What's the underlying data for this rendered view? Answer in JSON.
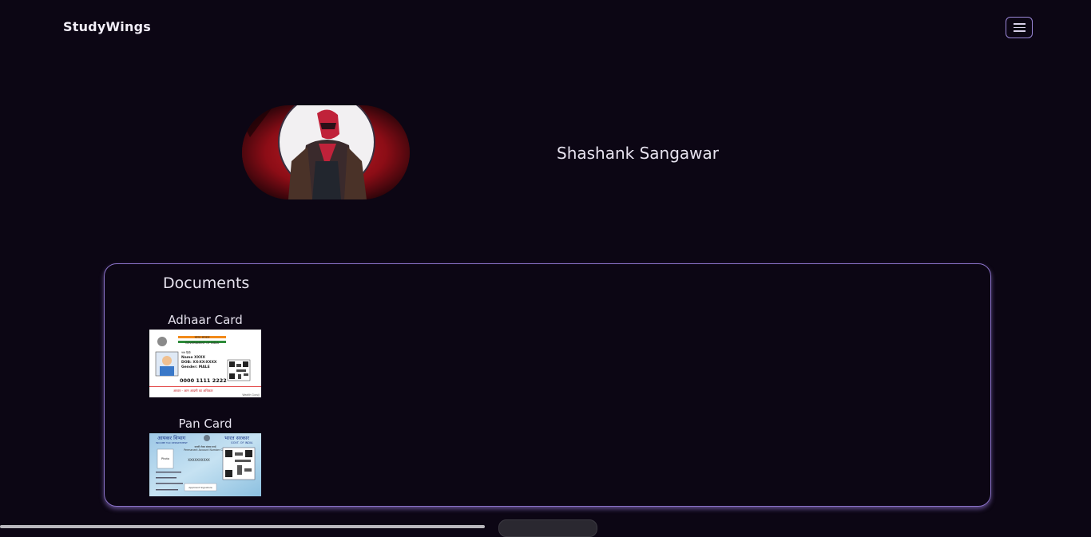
{
  "navbar": {
    "brand": "StudyWings",
    "menu_icon": "hamburger-menu-icon"
  },
  "profile": {
    "name": "Shashank Sangawar",
    "avatar_icon": "profile-avatar"
  },
  "documents": {
    "title": "Documents",
    "items": [
      {
        "label": "Adhaar Card",
        "image": "aadhaar-card-image",
        "card_text": {
          "header_hindi": "भारत सरकार",
          "header_english": "GOVERNMENT OF INDIA",
          "name_hindi": "नाम हिंदी",
          "name": "Name XXXX",
          "dob": "DOB: XX-XX-XXXX",
          "gender": "Gender: MALE",
          "number": "0000 1111 2222",
          "footer": "आधार - आम आदमी का अधिकार",
          "watermark": "Wealth Guruji"
        }
      },
      {
        "label": "Pan Card",
        "image": "pan-card-image",
        "card_text": {
          "dept_hindi": "आयकर विभाग",
          "dept_english": "INCOME TAX DEPARTMENT",
          "gov_hindi": "भारत सरकार",
          "gov_english": "GOVT. OF INDIA",
          "card_hindi": "स्थायी लेखा संख्या कार्ड",
          "card_english": "Permanent Account Number Card",
          "number": "XXXXXXXXXX",
          "photo": "Photo",
          "signature": "Applicant Signature"
        }
      }
    ]
  },
  "colors": {
    "background": "#0c0614",
    "card_border": "#8a72c8",
    "text": "#e6e2ee"
  }
}
